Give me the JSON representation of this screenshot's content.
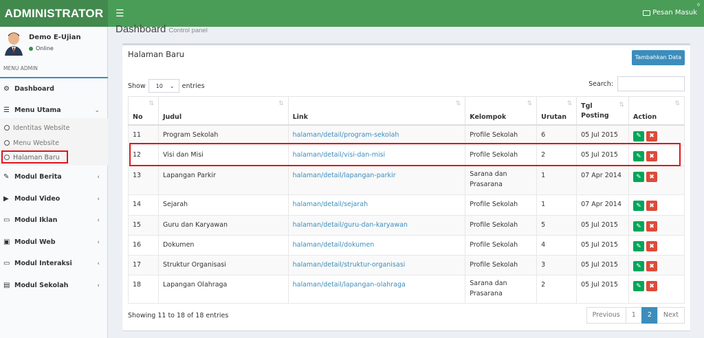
{
  "app": {
    "title": "ADMINISTRATOR",
    "messages_label": "Pesan Masuk",
    "messages_count": "0"
  },
  "user": {
    "name": "Demo E-Ujian",
    "status": "Online"
  },
  "sidebar": {
    "header": "MENU ADMIN",
    "items": [
      {
        "label": "Dashboard",
        "icon": "dashboard-icon"
      },
      {
        "label": "Menu Utama",
        "icon": "list-icon"
      },
      {
        "label": "Modul Berita",
        "icon": "pencil-icon"
      },
      {
        "label": "Modul Video",
        "icon": "play-icon"
      },
      {
        "label": "Modul Iklan",
        "icon": "desktop-icon"
      },
      {
        "label": "Modul Web",
        "icon": "image-icon"
      },
      {
        "label": "Modul Interaksi",
        "icon": "desktop-icon"
      },
      {
        "label": "Modul Sekolah",
        "icon": "bank-icon"
      }
    ],
    "submenu": [
      "Identitas Website",
      "Menu Website",
      "Halaman Baru"
    ]
  },
  "page": {
    "title": "Dashboard",
    "subtitle": "Control panel"
  },
  "box": {
    "title": "Halaman Baru",
    "add_button": "Tambahkan Data",
    "show_label": "Show",
    "entries_label": "entries",
    "page_size": "10",
    "search_label": "Search:"
  },
  "table": {
    "headers": [
      "No",
      "Judul",
      "Link",
      "Kelompok",
      "Urutan",
      "Tgl Posting",
      "Action"
    ],
    "rows": [
      [
        "11",
        "Program Sekolah",
        "halaman/detail/program-sekolah",
        "Profile Sekolah",
        "6",
        "05 Jul 2015"
      ],
      [
        "12",
        "Visi dan Misi",
        "halaman/detail/visi-dan-misi",
        "Profile Sekolah",
        "2",
        "05 Jul 2015"
      ],
      [
        "13",
        "Lapangan Parkir",
        "halaman/detail/lapangan-parkir",
        "Sarana dan Prasarana",
        "1",
        "07 Apr 2014"
      ],
      [
        "14",
        "Sejarah",
        "halaman/detail/sejarah",
        "Profile Sekolah",
        "1",
        "07 Apr 2014"
      ],
      [
        "15",
        "Guru dan Karyawan",
        "halaman/detail/guru-dan-karyawan",
        "Profile Sekolah",
        "5",
        "05 Jul 2015"
      ],
      [
        "16",
        "Dokumen",
        "halaman/detail/dokumen",
        "Profile Sekolah",
        "4",
        "05 Jul 2015"
      ],
      [
        "17",
        "Struktur Organisasi",
        "halaman/detail/struktur-organisasi",
        "Profile Sekolah",
        "3",
        "05 Jul 2015"
      ],
      [
        "18",
        "Lapangan Olahraga",
        "halaman/detail/lapangan-olahraga",
        "Sarana dan Prasarana",
        "2",
        "05 Jul 2015"
      ]
    ]
  },
  "footer": {
    "info": "Showing 11 to 18 of 18 entries",
    "previous": "Previous",
    "pages": [
      "1",
      "2"
    ],
    "current_page": "2",
    "next": "Next"
  },
  "colors": {
    "topbar": "#4a9d57",
    "logo": "#42894e",
    "primary": "#3c8dbc",
    "edit": "#00a65a",
    "delete": "#dd4b39",
    "highlight": "#e0141a"
  }
}
